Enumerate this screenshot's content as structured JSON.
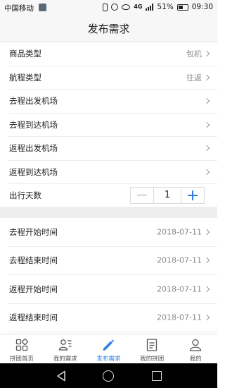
{
  "status_bar": {
    "carrier": "中国移动",
    "network": "4G",
    "battery": "51%",
    "time": "09:30"
  },
  "title": "发布需求",
  "fields": [
    {
      "label": "商品类型",
      "value": "包机"
    },
    {
      "label": "航程类型",
      "value": "往返"
    },
    {
      "label": "去程出发机场",
      "value": ""
    },
    {
      "label": "去程到达机场",
      "value": ""
    },
    {
      "label": "返程出发机场",
      "value": ""
    },
    {
      "label": "返程到达机场",
      "value": ""
    }
  ],
  "days": {
    "label": "出行天数",
    "value": "1"
  },
  "date_fields": [
    {
      "label": "去程开始时间",
      "value": "2018-07-11"
    },
    {
      "label": "去程结束时间",
      "value": "2018-07-11"
    },
    {
      "label": "返程开始时间",
      "value": "2018-07-11"
    },
    {
      "label": "返程结束时间",
      "value": "2018-07-11"
    }
  ],
  "tabs": [
    {
      "label": "拼团首页",
      "icon": "grid-icon",
      "active": false
    },
    {
      "label": "我的需求",
      "icon": "user-list-icon",
      "active": false
    },
    {
      "label": "发布需求",
      "icon": "pencil-icon",
      "active": true
    },
    {
      "label": "我的拼团",
      "icon": "document-icon",
      "active": false
    },
    {
      "label": "我的",
      "icon": "person-icon",
      "active": false
    }
  ],
  "colors": {
    "accent": "#2f7fe0",
    "value_text": "#8a8a8a",
    "section_gap": "#eeeeee"
  }
}
